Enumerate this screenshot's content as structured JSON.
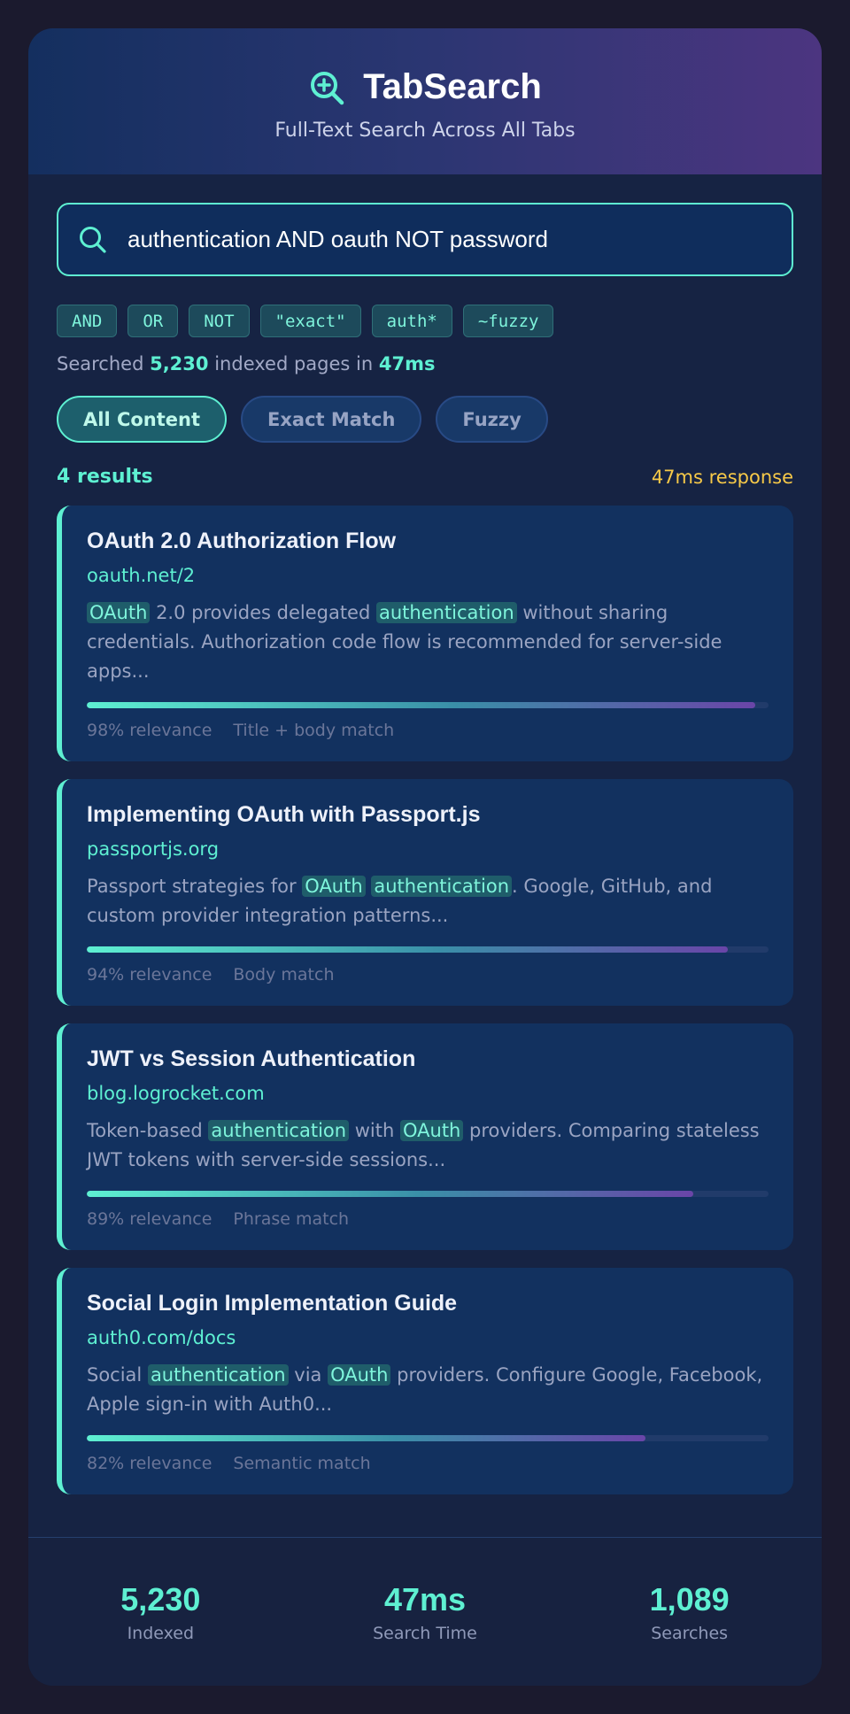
{
  "app": {
    "title": "TabSearch",
    "subtitle": "Full-Text Search Across All Tabs",
    "icon": "search-plus-icon",
    "accent": "#5ef0d2"
  },
  "search": {
    "query": "authentication AND oauth NOT password",
    "icon": "search-icon"
  },
  "operators": [
    "AND",
    "OR",
    "NOT",
    "\"exact\"",
    "auth*",
    "~fuzzy"
  ],
  "stats_line": {
    "prefix": "Searched",
    "count": "5,230",
    "middle": "indexed pages in",
    "time": "47ms"
  },
  "modes": [
    {
      "label": "All Content",
      "active": true
    },
    {
      "label": "Exact Match",
      "active": false
    },
    {
      "label": "Fuzzy",
      "active": false
    }
  ],
  "results_header": {
    "count": "4 results",
    "response": "47ms response"
  },
  "results": [
    {
      "title": "OAuth 2.0 Authorization Flow",
      "url": "oauth.net/2",
      "snippet": [
        {
          "t": "OAuth",
          "hl": true
        },
        {
          "t": " 2.0 provides delegated ",
          "hl": false
        },
        {
          "t": "authentication",
          "hl": true
        },
        {
          "t": " without sharing credentials. Authorization code flow is recommended for server-side apps...",
          "hl": false
        }
      ],
      "relevance_value": 0.98,
      "relevance": "98% relevance",
      "match": "Title + body match"
    },
    {
      "title": "Implementing OAuth with Passport.js",
      "url": "passportjs.org",
      "snippet": [
        {
          "t": "Passport strategies for ",
          "hl": false
        },
        {
          "t": "OAuth",
          "hl": true
        },
        {
          "t": " ",
          "hl": false
        },
        {
          "t": "authentication",
          "hl": true
        },
        {
          "t": ". Google, GitHub, and custom provider integration patterns...",
          "hl": false
        }
      ],
      "relevance_value": 0.94,
      "relevance": "94% relevance",
      "match": "Body match"
    },
    {
      "title": "JWT vs Session Authentication",
      "url": "blog.logrocket.com",
      "snippet": [
        {
          "t": "Token-based ",
          "hl": false
        },
        {
          "t": "authentication",
          "hl": true
        },
        {
          "t": " with ",
          "hl": false
        },
        {
          "t": "OAuth",
          "hl": true
        },
        {
          "t": " providers. Comparing stateless JWT tokens with server-side sessions...",
          "hl": false
        }
      ],
      "relevance_value": 0.89,
      "relevance": "89% relevance",
      "match": "Phrase match"
    },
    {
      "title": "Social Login Implementation Guide",
      "url": "auth0.com/docs",
      "snippet": [
        {
          "t": "Social ",
          "hl": false
        },
        {
          "t": "authentication",
          "hl": true
        },
        {
          "t": " via ",
          "hl": false
        },
        {
          "t": "OAuth",
          "hl": true
        },
        {
          "t": " providers. Configure Google, Facebook, Apple sign-in with Auth0...",
          "hl": false
        }
      ],
      "relevance_value": 0.82,
      "relevance": "82% relevance",
      "match": "Semantic match"
    }
  ],
  "footer": [
    {
      "value": "5,230",
      "label": "Indexed"
    },
    {
      "value": "47ms",
      "label": "Search Time"
    },
    {
      "value": "1,089",
      "label": "Searches"
    }
  ]
}
